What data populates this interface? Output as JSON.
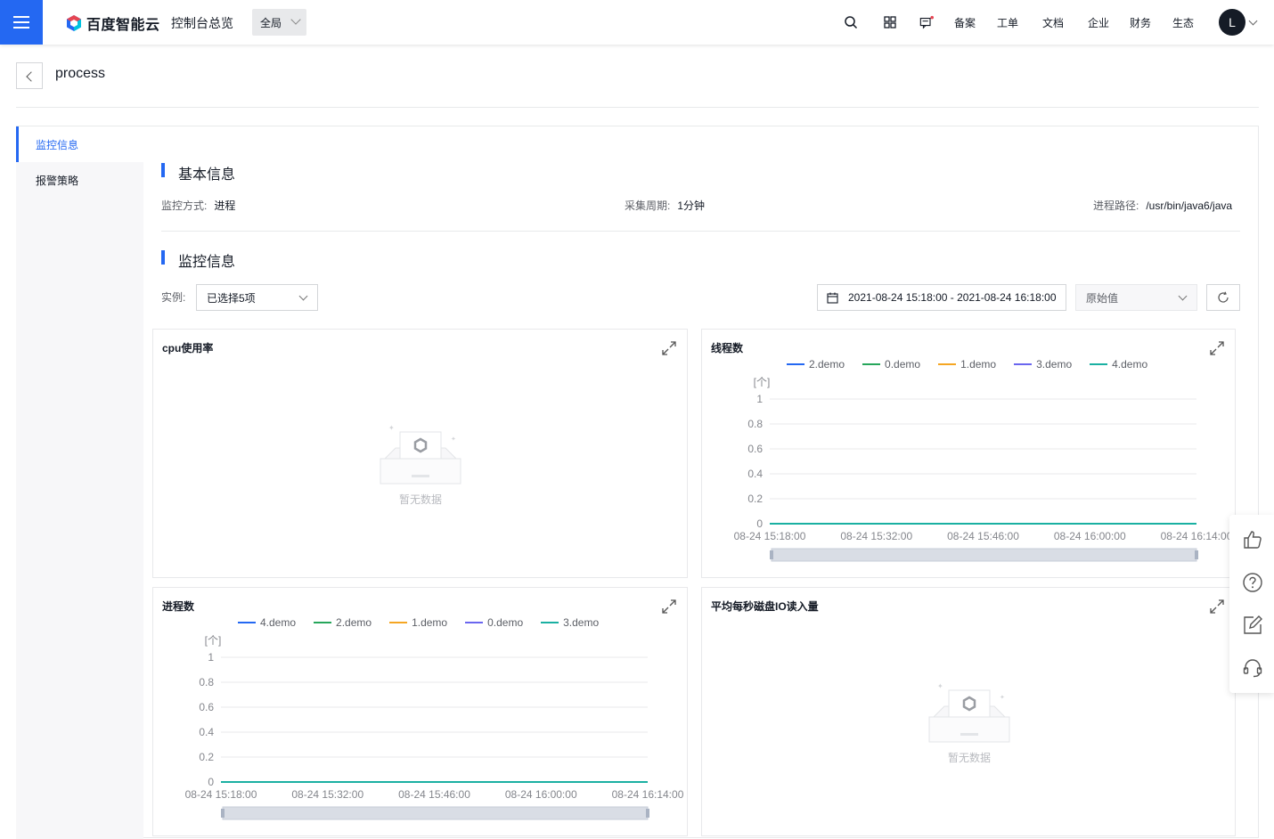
{
  "nav": {
    "logo_text": "百度智能云",
    "console": "控制台总览",
    "region": "全局",
    "items": [
      "备案",
      "工单",
      "文档",
      "企业",
      "财务",
      "生态"
    ],
    "avatar": "L"
  },
  "page": {
    "title": "process"
  },
  "sidebar": {
    "items": [
      {
        "label": "监控信息",
        "active": true
      },
      {
        "label": "报警策略",
        "active": false
      }
    ]
  },
  "basic": {
    "title": "基本信息",
    "method_label": "监控方式:",
    "method_value": "进程",
    "period_label": "采集周期:",
    "period_value": "1分钟",
    "path_label": "进程路径:",
    "path_value": "/usr/bin/java6/java"
  },
  "monitor": {
    "title": "监控信息",
    "instance_label": "实例:",
    "instance_value": "已选择5项",
    "time_range": "2021-08-24 15:18:00 - 2021-08-24 16:18:00",
    "value_type": "原始值"
  },
  "colors": {
    "accent": "#2468f2",
    "series": [
      "#2468f2",
      "#26a65b",
      "#f5a623",
      "#6a66ef",
      "#1ab0a2"
    ]
  },
  "cards": {
    "cpu": {
      "title": "cpu使用率",
      "empty": "暂无数据"
    },
    "threads": {
      "title": "线程数",
      "unit": "[个]",
      "legend": [
        "2.demo",
        "0.demo",
        "1.demo",
        "3.demo",
        "4.demo"
      ]
    },
    "procs": {
      "title": "进程数",
      "unit": "[个]",
      "legend": [
        "4.demo",
        "2.demo",
        "1.demo",
        "0.demo",
        "3.demo"
      ]
    },
    "diskio": {
      "title": "平均每秒磁盘IO读入量",
      "empty": "暂无数据"
    }
  },
  "chart_data": [
    {
      "type": "line",
      "title": "线程数",
      "ylabel": "[个]",
      "ylim": [
        0,
        1
      ],
      "yticks": [
        "1",
        "0.8",
        "0.6",
        "0.4",
        "0.2",
        "0"
      ],
      "x": [
        "08-24 15:18:00",
        "08-24 15:32:00",
        "08-24 15:46:00",
        "08-24 16:00:00",
        "08-24 16:14:00"
      ],
      "series": [
        {
          "name": "2.demo",
          "values": [
            0,
            0,
            0,
            0,
            0
          ]
        },
        {
          "name": "0.demo",
          "values": [
            0,
            0,
            0,
            0,
            0
          ]
        },
        {
          "name": "1.demo",
          "values": [
            0,
            0,
            0,
            0,
            0
          ]
        },
        {
          "name": "3.demo",
          "values": [
            0,
            0,
            0,
            0,
            0
          ]
        },
        {
          "name": "4.demo",
          "values": [
            0,
            0,
            0,
            0,
            0
          ]
        }
      ],
      "legend": "top",
      "grid": true
    },
    {
      "type": "line",
      "title": "进程数",
      "ylabel": "[个]",
      "ylim": [
        0,
        1
      ],
      "yticks": [
        "1",
        "0.8",
        "0.6",
        "0.4",
        "0.2",
        "0"
      ],
      "x": [
        "08-24 15:18:00",
        "08-24 15:32:00",
        "08-24 15:46:00",
        "08-24 16:00:00",
        "08-24 16:14:00"
      ],
      "series": [
        {
          "name": "4.demo",
          "values": [
            0,
            0,
            0,
            0,
            0
          ]
        },
        {
          "name": "2.demo",
          "values": [
            0,
            0,
            0,
            0,
            0
          ]
        },
        {
          "name": "1.demo",
          "values": [
            0,
            0,
            0,
            0,
            0
          ]
        },
        {
          "name": "0.demo",
          "values": [
            0,
            0,
            0,
            0,
            0
          ]
        },
        {
          "name": "3.demo",
          "values": [
            0,
            0,
            0,
            0,
            0
          ]
        }
      ],
      "legend": "top",
      "grid": true
    }
  ]
}
